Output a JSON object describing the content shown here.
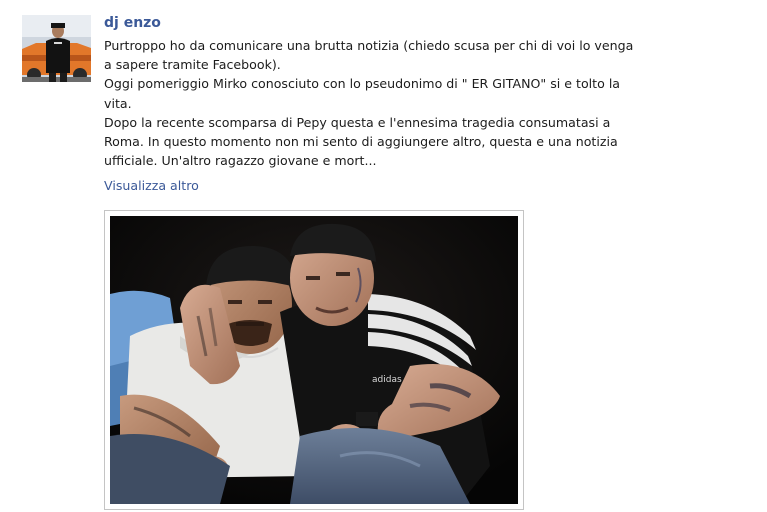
{
  "post": {
    "author": "dj enzo",
    "message_lines": [
      "Purtroppo ho da comunicare una brutta notizia (chiedo scusa per chi di voi lo venga",
      "a sapere tramite Facebook).",
      "Oggi pomeriggio Mirko conosciuto con lo pseudonimo di \" ER GITANO\" si e tolto la",
      "vita.",
      "Dopo la recente scomparsa di Pepy questa e l'ennesima tragedia consumatasi a",
      "Roma. In questo momento non mi sento di aggiungere altro, questa e una notizia",
      "ufficiale. Un'altro ragazzo giovane e mort..."
    ],
    "see_more": "Visualizza altro",
    "photo_logo_text": "adidas"
  },
  "colors": {
    "link": "#3b5998",
    "text": "#1c1c1c",
    "photo_border": "#c4c4c4"
  }
}
